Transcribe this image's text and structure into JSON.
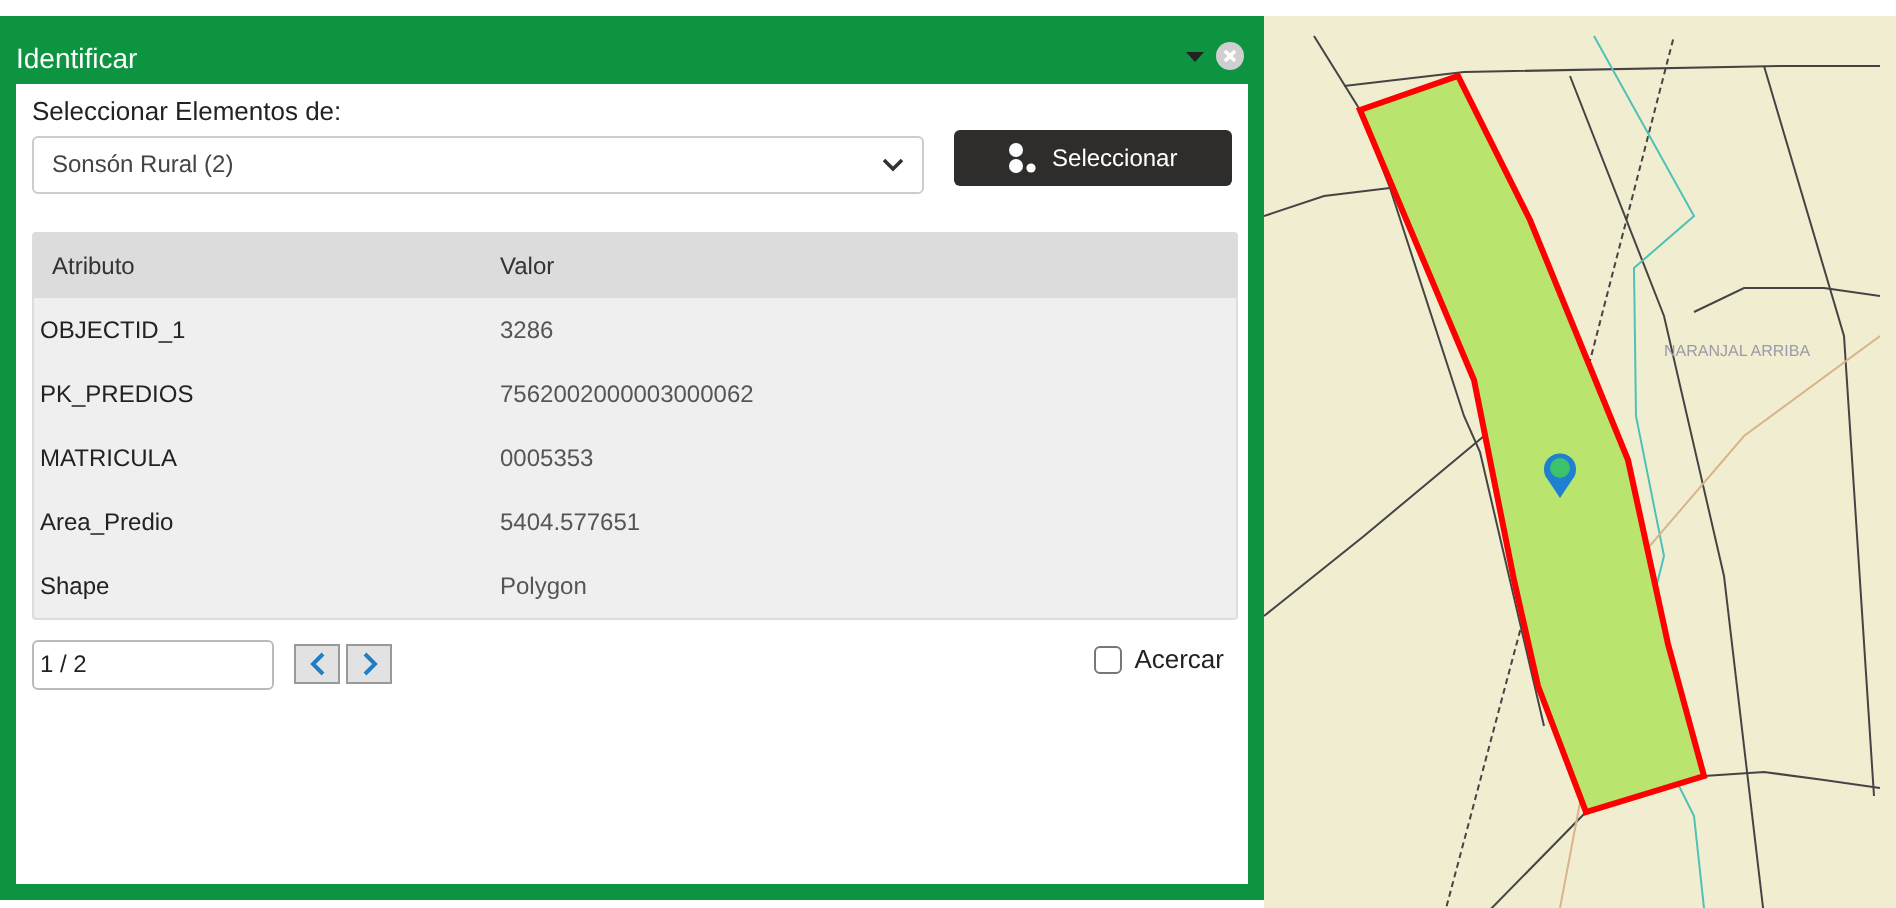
{
  "dialog": {
    "title": "Identificar",
    "select_label": "Seleccionar Elementos de:",
    "select_value": "Sonsón Rural (2)",
    "select_button": "Seleccionar"
  },
  "table": {
    "columns": [
      "Atributo",
      "Valor"
    ],
    "rows": [
      [
        "OBJECTID_1",
        "3286"
      ],
      [
        "PK_PREDIOS",
        "7562002000003000062"
      ],
      [
        "MATRICULA",
        "0005353"
      ],
      [
        "Area_Predio",
        "5404.577651"
      ],
      [
        "Shape",
        "Polygon"
      ]
    ]
  },
  "pager": {
    "value": "1 / 2"
  },
  "zoom_option": {
    "label": "Acercar",
    "checked": false
  },
  "map": {
    "place_label": "NARANJAL ARRIBA"
  }
}
